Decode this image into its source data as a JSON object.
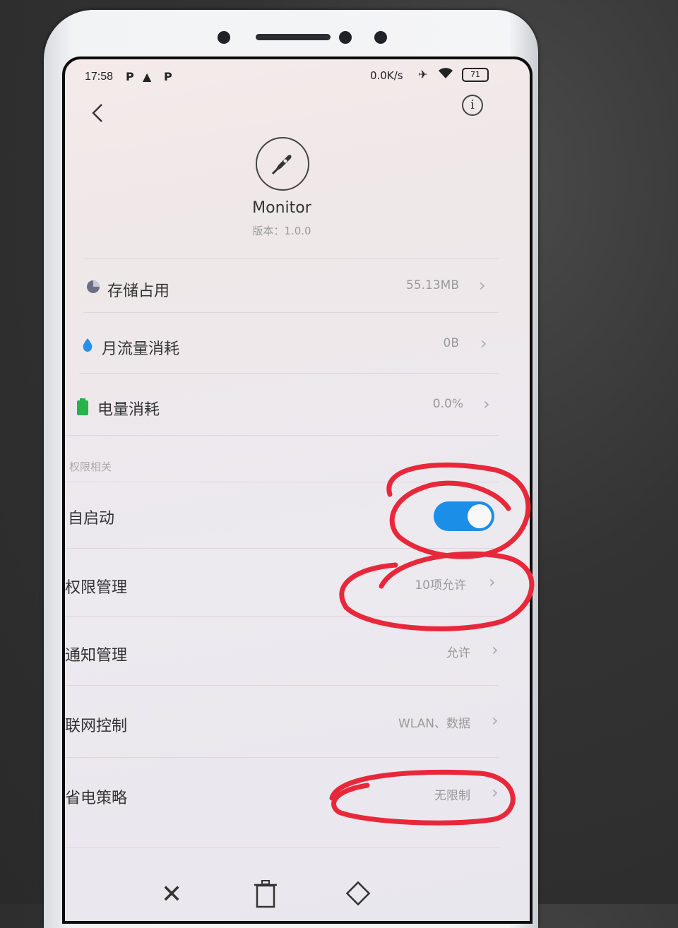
{
  "status_bar": {
    "time": "17:58",
    "icons": [
      "P",
      "▲",
      "P"
    ],
    "speed": "0.0K/s",
    "battery": "71"
  },
  "header": {
    "back_icon": "chevron-left-icon",
    "info_icon": "info-icon"
  },
  "app": {
    "name": "Monitor",
    "version": "版本：1.0.0",
    "icon": "rocket-icon"
  },
  "usage": [
    {
      "label": "存储占用",
      "value": "55.13MB",
      "icon_color": "#6b6f86"
    },
    {
      "label": "月流量消耗",
      "value": "0B",
      "icon_color": "#2b8fe6"
    },
    {
      "label": "电量消耗",
      "value": "0.0%",
      "icon_color": "#27b34a"
    }
  ],
  "permissions": {
    "section_label": "权限相关",
    "autostart": {
      "label": "自启动",
      "enabled": true
    },
    "rows": [
      {
        "label": "权限管理",
        "value": "10项允许"
      },
      {
        "label": "通知管理",
        "value": "允许"
      },
      {
        "label": "联网控制",
        "value": "WLAN、数据"
      },
      {
        "label": "省电策略",
        "value": "无限制"
      }
    ]
  },
  "bottom_bar": {
    "icons": [
      "close-icon",
      "trash-icon",
      "eraser-icon"
    ]
  },
  "colors": {
    "accent": "#1b8ee8",
    "annotation": "#e8283a"
  }
}
